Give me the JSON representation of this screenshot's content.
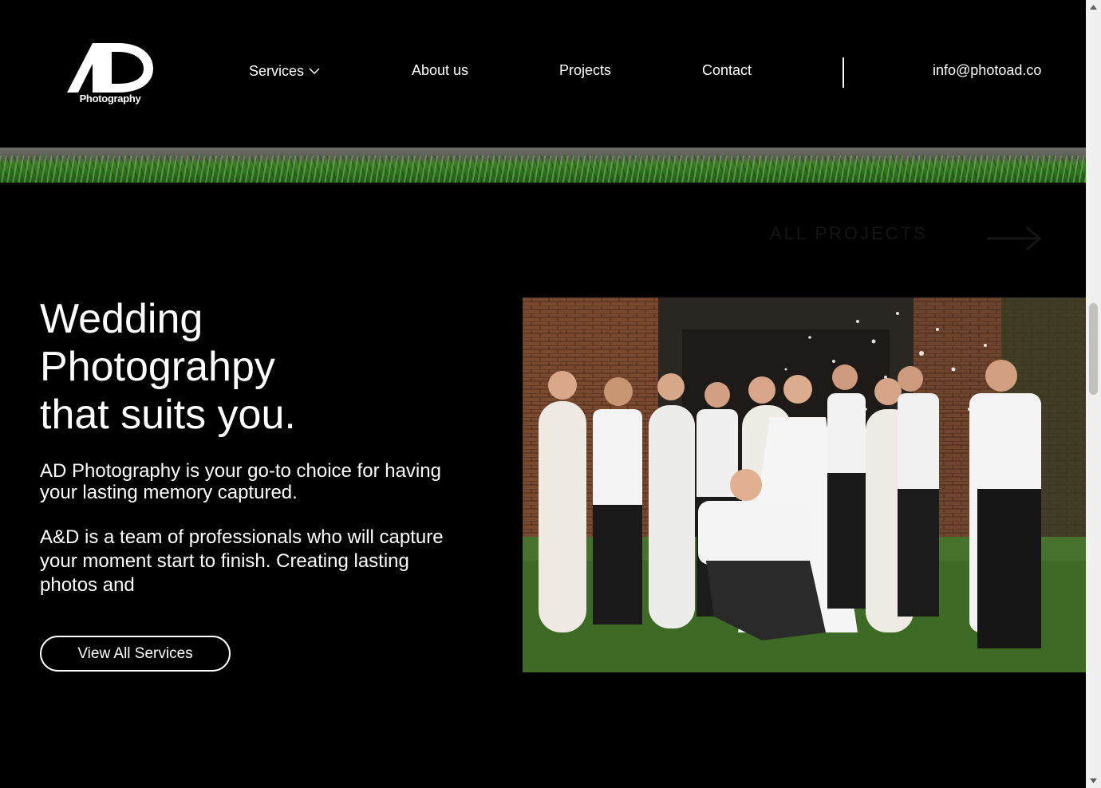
{
  "header": {
    "logo_caption": "Photography",
    "logo_monogram": "AD",
    "nav": {
      "services": "Services",
      "about": "About us",
      "projects": "Projects",
      "contact": "Contact"
    },
    "email": "info@photoad.co"
  },
  "hero": {
    "ghost_link": "ALL PROJECTS",
    "title_line1": "Wedding",
    "title_line2": "Photograhpy",
    "title_line3": "that suits you.",
    "paragraph1": "AD Photography is your go-to choice for having your lasting memory captured.",
    "paragraph2": "A&D is a team of professionals who will capture your moment start to finish. Creating lasting photos and",
    "button": "View All Services"
  },
  "icons": {
    "dropdown": "chevron-down-icon",
    "arrow": "arrow-right-icon"
  },
  "colors": {
    "background": "#000000",
    "text": "#ffffff",
    "scrollbar_track": "#f0f0f0",
    "scrollbar_thumb": "#c1c1c1"
  }
}
